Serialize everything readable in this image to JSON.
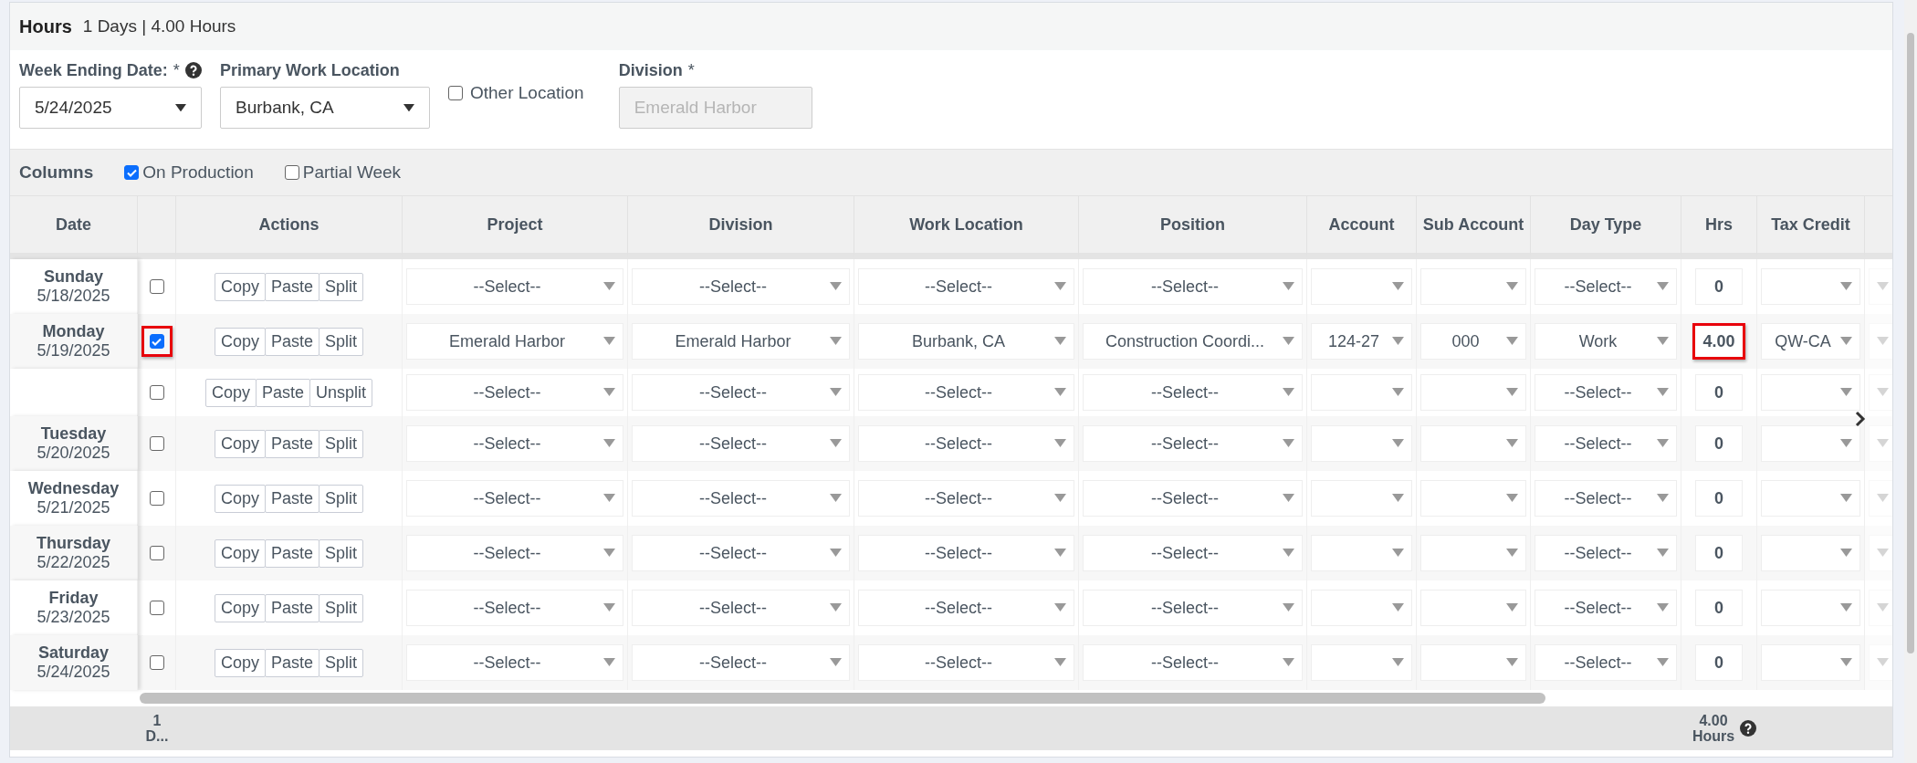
{
  "header": {
    "title": "Hours",
    "summary": "1 Days | 4.00 Hours"
  },
  "form": {
    "week_ending": {
      "label": "Week Ending Date:",
      "required_mark": "*",
      "value": "5/24/2025"
    },
    "primary_location": {
      "label": "Primary Work Location",
      "value": "Burbank, CA"
    },
    "other_location": {
      "label": "Other Location",
      "checked": false
    },
    "division": {
      "label": "Division",
      "required_mark": "*",
      "value": "Emerald Harbor",
      "disabled": true
    }
  },
  "columns_bar": {
    "label": "Columns",
    "options": [
      {
        "label": "On Production",
        "checked": true
      },
      {
        "label": "Partial Week",
        "checked": false
      }
    ]
  },
  "table": {
    "columns": [
      "Date",
      "Actions",
      "Project",
      "Division",
      "Work Location",
      "Position",
      "Account",
      "Sub Account",
      "Day Type",
      "Hrs",
      "Tax Credit"
    ],
    "rows": [
      {
        "day": "Sunday",
        "date": "5/18/2025",
        "checked": false,
        "highlighted": false,
        "actions": [
          "Copy",
          "Paste",
          "Split"
        ],
        "project": "--Select--",
        "division": "--Select--",
        "work_location": "--Select--",
        "position": "--Select--",
        "day_type": "--Select--",
        "hrs": "0",
        "hrs_highlighted": false
      },
      {
        "day": "Monday",
        "date": "5/19/2025",
        "checked": true,
        "highlighted": true,
        "actions": [
          "Copy",
          "Paste",
          "Split"
        ],
        "project": "Emerald Harbor",
        "division": "Emerald Harbor",
        "work_location": "Burbank, CA",
        "position": "Construction Coordi...",
        "account": "124-27",
        "sub_account": "000",
        "day_type": "Work",
        "hrs": "4.00",
        "hrs_highlighted": true,
        "tax_credit": "QW-CA"
      },
      {
        "checked": false,
        "highlighted": false,
        "actions": [
          "Copy",
          "Paste",
          "Unsplit"
        ],
        "project": "--Select--",
        "division": "--Select--",
        "work_location": "--Select--",
        "position": "--Select--",
        "day_type": "--Select--",
        "hrs": "0",
        "hrs_highlighted": false
      },
      {
        "day": "Tuesday",
        "date": "5/20/2025",
        "checked": false,
        "highlighted": false,
        "actions": [
          "Copy",
          "Paste",
          "Split"
        ],
        "project": "--Select--",
        "division": "--Select--",
        "work_location": "--Select--",
        "position": "--Select--",
        "day_type": "--Select--",
        "hrs": "0",
        "hrs_highlighted": false
      },
      {
        "day": "Wednesday",
        "date": "5/21/2025",
        "checked": false,
        "highlighted": false,
        "actions": [
          "Copy",
          "Paste",
          "Split"
        ],
        "project": "--Select--",
        "division": "--Select--",
        "work_location": "--Select--",
        "position": "--Select--",
        "day_type": "--Select--",
        "hrs": "0",
        "hrs_highlighted": false
      },
      {
        "day": "Thursday",
        "date": "5/22/2025",
        "checked": false,
        "highlighted": false,
        "actions": [
          "Copy",
          "Paste",
          "Split"
        ],
        "project": "--Select--",
        "division": "--Select--",
        "work_location": "--Select--",
        "position": "--Select--",
        "day_type": "--Select--",
        "hrs": "0",
        "hrs_highlighted": false
      },
      {
        "day": "Friday",
        "date": "5/23/2025",
        "checked": false,
        "highlighted": false,
        "actions": [
          "Copy",
          "Paste",
          "Split"
        ],
        "project": "--Select--",
        "division": "--Select--",
        "work_location": "--Select--",
        "position": "--Select--",
        "day_type": "--Select--",
        "hrs": "0",
        "hrs_highlighted": false
      },
      {
        "day": "Saturday",
        "date": "5/24/2025",
        "checked": false,
        "highlighted": false,
        "actions": [
          "Copy",
          "Paste",
          "Split"
        ],
        "project": "--Select--",
        "division": "--Select--",
        "work_location": "--Select--",
        "position": "--Select--",
        "day_type": "--Select--",
        "hrs": "0",
        "hrs_highlighted": false
      }
    ],
    "footer": {
      "days": "1 D...",
      "hours": "4.00 Hours"
    }
  }
}
